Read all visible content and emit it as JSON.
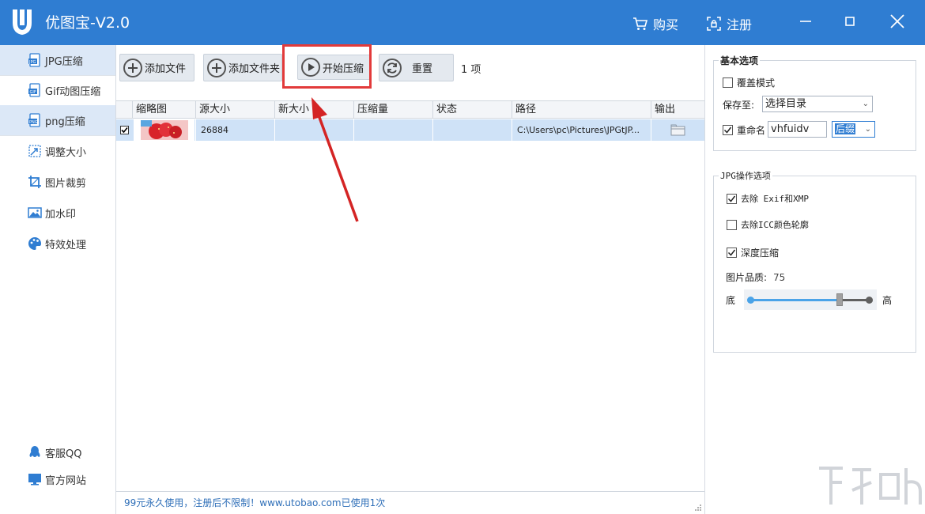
{
  "app": {
    "title": "优图宝-V2.0",
    "buy_label": "购买",
    "register_label": "注册",
    "accent": "#2f7dd2"
  },
  "sidebar": {
    "items": [
      {
        "label": "JPG压缩",
        "icon": "jpg-file-icon"
      },
      {
        "label": "Gif动图压缩",
        "icon": "gif-file-icon"
      },
      {
        "label": "png压缩",
        "icon": "png-file-icon"
      },
      {
        "label": "调整大小",
        "icon": "resize-icon"
      },
      {
        "label": "图片裁剪",
        "icon": "crop-icon"
      },
      {
        "label": "加水印",
        "icon": "image-icon"
      },
      {
        "label": "特效处理",
        "icon": "palette-icon"
      }
    ],
    "support_label": "客服QQ",
    "website_label": "官方网站"
  },
  "toolbar": {
    "add_file_label": "添加文件",
    "add_folder_label": "添加文件夹",
    "start_label": "开始压缩",
    "reset_label": "重置",
    "count_label": "1 项"
  },
  "table": {
    "columns": [
      "缩略图",
      "源大小",
      "新大小",
      "压缩量",
      "状态",
      "路径",
      "输出"
    ],
    "rows": [
      {
        "checked": true,
        "source_size": "26884",
        "new_size": "",
        "reduction": "",
        "status": "",
        "path": "C:\\Users\\pc\\Pictures\\JPGtJP..."
      }
    ]
  },
  "status_bar": {
    "text": "99元永久使用，注册后不限制！www.utobao.com已使用1次"
  },
  "basic_options": {
    "title": "基本选项",
    "overwrite_label": "覆盖模式",
    "overwrite_checked": false,
    "save_to_label": "保存至:",
    "save_to_value": "选择目录",
    "rename_label": "重命名",
    "rename_checked": true,
    "rename_value": "vhfuidv",
    "rename_position_value": "后缀"
  },
  "jpg_options": {
    "title": "JPG操作选项",
    "remove_exif_label": "去除 Exif和XMP",
    "remove_exif_checked": true,
    "remove_icc_label": "去除ICC颜色轮廓",
    "remove_icc_checked": false,
    "deep_compress_label": "深度压缩",
    "deep_compress_checked": true,
    "quality_label": "图片品质:",
    "quality_value": "75",
    "low_label": "底",
    "high_label": "高",
    "quality_fraction": 0.75
  }
}
